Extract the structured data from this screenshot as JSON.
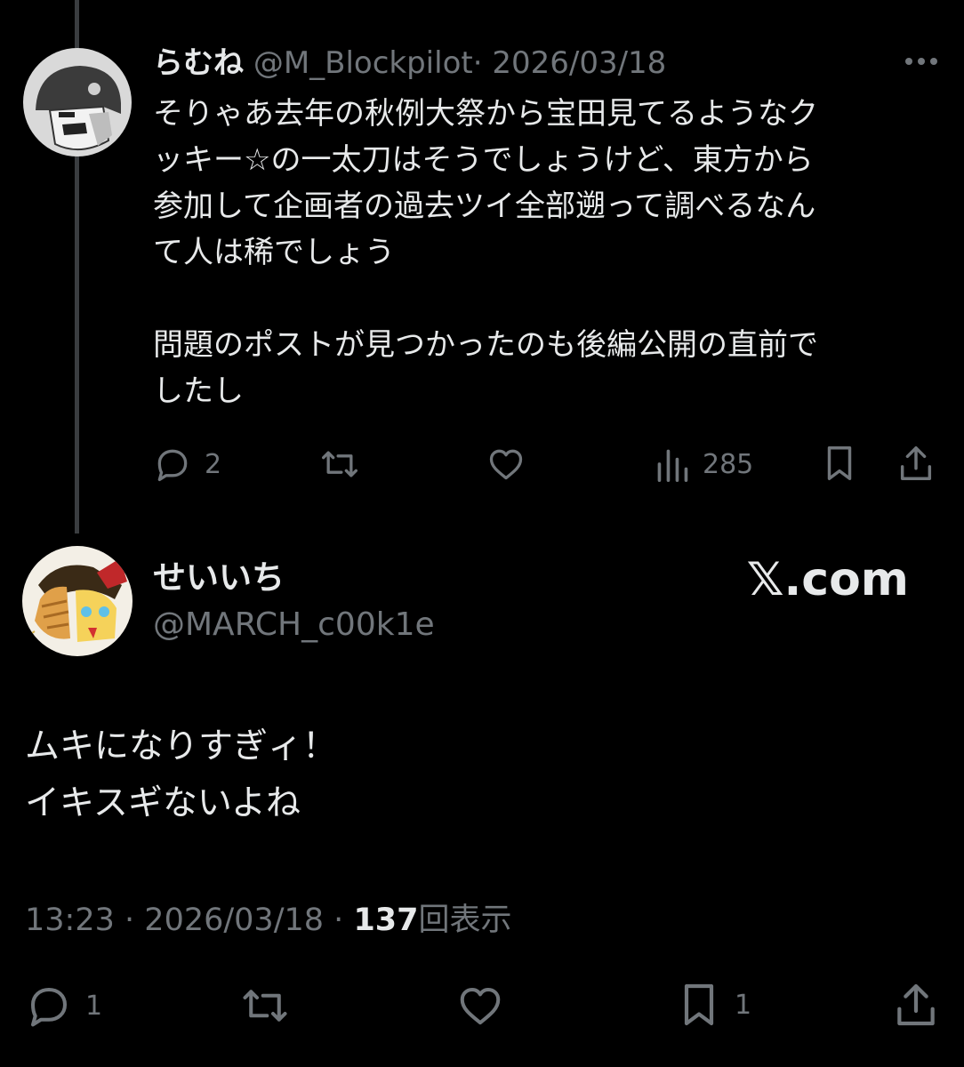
{
  "reply": {
    "display_name": "らむね",
    "handle": "@M_Blockpilot",
    "separator": "·",
    "date": "2026/03/18",
    "text_lines": [
      "そりゃあ去年の秋例大祭から宝田見てるようなク",
      "ッキー☆の一太刀はそうでしょうけど、東方から",
      "参加して企画者の過去ツイ全部遡って調べるなん",
      "て人は稀でしょう",
      "",
      "問題のポストが見つかったのも後編公開の直前で",
      "したし"
    ],
    "stats": {
      "replies": "2",
      "views": "285"
    }
  },
  "main": {
    "display_name": "せいいち",
    "handle": "@MARCH_c00k1e",
    "watermark": "𝕏.com",
    "text_lines": [
      "ムキになりすぎィ！",
      "イキスギないよね"
    ],
    "time": "13:23",
    "separator": "·",
    "date": "2026/03/18",
    "views_count": "137",
    "views_label": "回表示",
    "stats": {
      "replies": "1",
      "bookmarks": "1"
    }
  },
  "icons": [
    "more-icon",
    "reply-icon",
    "retweet-icon",
    "like-icon",
    "views-icon",
    "bookmark-icon",
    "share-icon"
  ],
  "colors": {
    "background": "#000000",
    "text": "#e7e9ea",
    "muted": "#71767b",
    "thread_line": "#3a3d40"
  }
}
